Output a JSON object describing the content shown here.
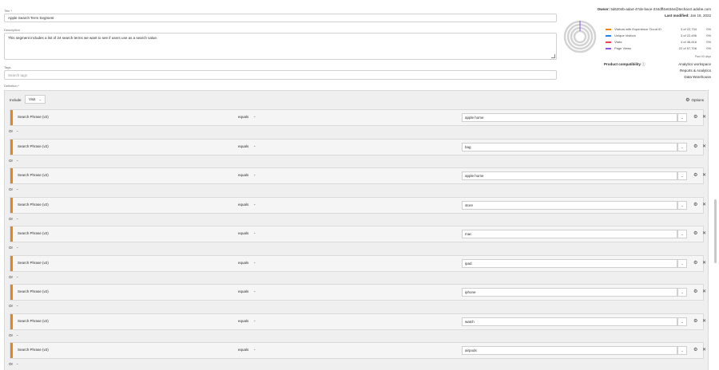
{
  "title_field": {
    "label": "Title *",
    "value": "Apple Search Term Segment"
  },
  "description_field": {
    "label": "Description",
    "value": "This segment includes a list of 24 search terms we want to see if users use as a search value."
  },
  "tags_field": {
    "label": "Tags",
    "placeholder": "Search tags"
  },
  "definition": {
    "label": "Definition *",
    "include_label": "Include",
    "container": "Visit",
    "options_label": "Options"
  },
  "owner": {
    "label": "Owner:",
    "value": "5d6204b-ada4-47de-bace-234dff4e634e@techacct.adobe.com"
  },
  "last_modified": {
    "label": "Last modified:",
    "value": "Jan 18, 2022"
  },
  "summary": {
    "rows": [
      {
        "name": "Visitors with Experience Cloud ID",
        "count": "3 of 22,734",
        "pct": "0%",
        "color": "#e68619"
      },
      {
        "name": "Unique Visitors",
        "count": "3 of 22,496",
        "pct": "0%",
        "color": "#2680eb"
      },
      {
        "name": "Visits",
        "count": "4 of 46,616",
        "pct": "0%",
        "color": "#e34850"
      },
      {
        "name": "Page Views",
        "count": "22 of 57,706",
        "pct": "0%",
        "color": "#9256d9"
      }
    ],
    "range": "Past 90 days"
  },
  "compat": {
    "label": "Product compatibility",
    "items": [
      "Analytics workspace",
      "Reports & Analytics",
      "Data Warehouse"
    ]
  },
  "rules": [
    {
      "dimension": "Search Phrase (v2)",
      "operator": "equals",
      "value": "apple home"
    },
    {
      "dimension": "Search Phrase (v2)",
      "operator": "equals",
      "value": "bag"
    },
    {
      "dimension": "Search Phrase (v2)",
      "operator": "equals",
      "value": "apple home"
    },
    {
      "dimension": "Search Phrase (v2)",
      "operator": "equals",
      "value": "store"
    },
    {
      "dimension": "Search Phrase (v2)",
      "operator": "equals",
      "value": "mac"
    },
    {
      "dimension": "Search Phrase (v2)",
      "operator": "equals",
      "value": "ipad"
    },
    {
      "dimension": "Search Phrase (v2)",
      "operator": "equals",
      "value": "iphone"
    },
    {
      "dimension": "Search Phrase (v2)",
      "operator": "equals",
      "value": "watch"
    },
    {
      "dimension": "Search Phrase (v2)",
      "operator": "equals",
      "value": "airpods"
    }
  ],
  "or_label": "Or"
}
